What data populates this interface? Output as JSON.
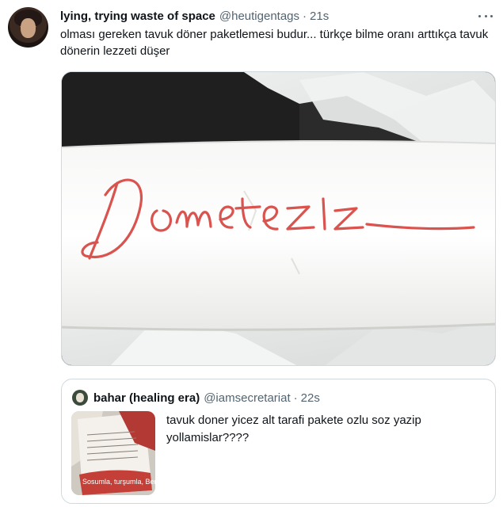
{
  "tweet": {
    "display_name": "lying, trying waste of space",
    "handle": "@heutigentags",
    "separator": "·",
    "time": "21s",
    "text": "olması gereken tavuk döner paketlemesi budur... türkçe bilme oranı arttıkça tavuk dönerin lezzeti düşer",
    "photo_handwriting": "Dometeziz"
  },
  "quoted_tweet": {
    "display_name": "bahar (healing era)",
    "handle": "@iamsecretariat",
    "separator": "·",
    "time": "22s",
    "text": "tavuk doner yicez alt tarafi pakete ozlu soz yazip yollamislar????",
    "thumbnail_caption": "Sosumla, turşumla, Beni Böyle Sev..."
  },
  "colors": {
    "text_primary": "#0f1419",
    "text_secondary": "#536471",
    "border": "#cfd9de",
    "handwriting_red": "#d9534f"
  },
  "icons": {
    "more_menu": "more-horizontal-icon"
  }
}
